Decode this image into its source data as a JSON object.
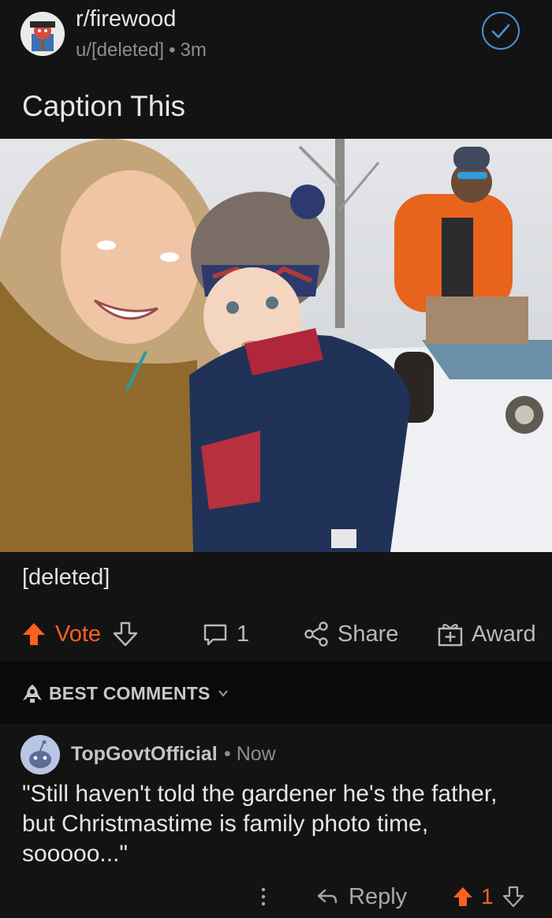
{
  "post": {
    "subreddit": "r/firewood",
    "author": "u/[deleted]",
    "separator": "•",
    "age": "3m",
    "title": "Caption This",
    "body": "[deleted]",
    "image_icon": "photo-image"
  },
  "actions": {
    "vote_label": "Vote",
    "comment_count": "1",
    "share_label": "Share",
    "award_label": "Award"
  },
  "comments_header": {
    "sort_label": "BEST COMMENTS"
  },
  "comment": {
    "username": "TopGovtOfficial",
    "separator": "•",
    "time": "Now",
    "text": "\"Still haven't told the gardener he's the father, but Christmastime is family photo time, sooooo...\"",
    "reply_label": "Reply",
    "score": "1"
  },
  "colors": {
    "background": "#131313",
    "upvote_accent": "#ff5f1f",
    "joined_accent": "#4a8fd9"
  }
}
